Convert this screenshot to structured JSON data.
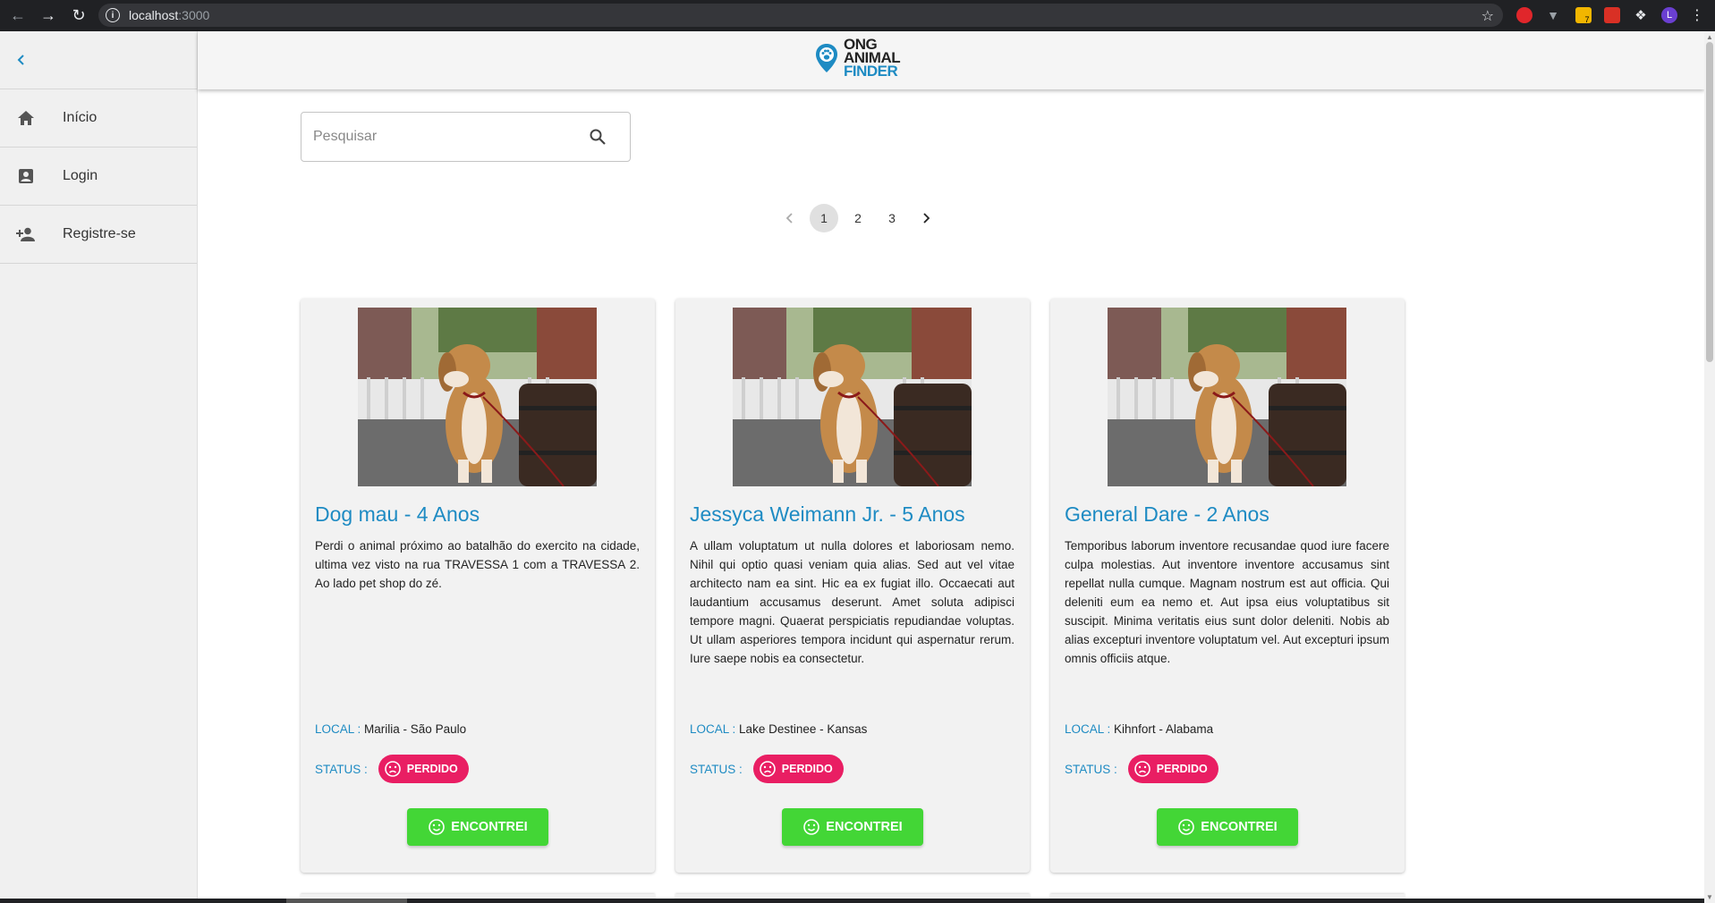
{
  "browser": {
    "url_host": "localhost",
    "url_port": ":3000",
    "profile_initial": "L",
    "ext_badge": "7"
  },
  "sidebar": {
    "items": [
      {
        "label": "Início",
        "icon": "home-icon"
      },
      {
        "label": "Login",
        "icon": "account-box-icon"
      },
      {
        "label": "Registre-se",
        "icon": "person-add-icon"
      }
    ]
  },
  "header": {
    "logo_line1": "ONG",
    "logo_line2": "ANIMAL",
    "logo_line3": "FINDER"
  },
  "search": {
    "placeholder": "Pesquisar"
  },
  "pagination": {
    "pages": [
      "1",
      "2",
      "3"
    ],
    "current": "1"
  },
  "cards": [
    {
      "title": "Dog mau - 4 Anos",
      "description": "Perdi o animal próximo ao batalhão do exercito na cidade, ultima vez visto na rua TRAVESSA 1 com a TRAVESSA 2. Ao lado pet shop do zé.",
      "local_label": "LOCAL :",
      "local": "Marilia - São Paulo",
      "status_label": "STATUS :",
      "status": "PERDIDO",
      "button": "ENCONTREI"
    },
    {
      "title": "Jessyca Weimann Jr. - 5 Anos",
      "description": "A ullam voluptatum ut nulla dolores et laboriosam nemo. Nihil qui optio quasi veniam quia alias. Sed aut vel vitae architecto nam ea sint. Hic ea ex fugiat illo. Occaecati aut laudantium accusamus deserunt. Amet soluta adipisci tempore magni. Quaerat perspiciatis repudiandae voluptas. Ut ullam asperiores tempora incidunt qui aspernatur rerum. Iure saepe nobis ea consectetur.",
      "local_label": "LOCAL :",
      "local": "Lake Destinee - Kansas",
      "status_label": "STATUS :",
      "status": "PERDIDO",
      "button": "ENCONTREI"
    },
    {
      "title": "General Dare - 2 Anos",
      "description": "Temporibus laborum inventore recusandae quod iure facere culpa molestias. Aut inventore inventore accusamus sint repellat nulla cumque. Magnam nostrum est aut officia. Qui deleniti eum ea nemo et. Aut ipsa eius voluptatibus sit suscipit. Minima veritatis eius sunt dolor deleniti. Nobis ab alias excepturi inventore voluptatum vel. Aut excepturi ipsum omnis officiis atque.",
      "local_label": "LOCAL :",
      "local": "Kihnfort - Alabama",
      "status_label": "STATUS :",
      "status": "PERDIDO",
      "button": "ENCONTREI"
    }
  ],
  "colors": {
    "accent": "#1e8bc3",
    "status_lost": "#e91e63",
    "found_button": "#43d636"
  }
}
